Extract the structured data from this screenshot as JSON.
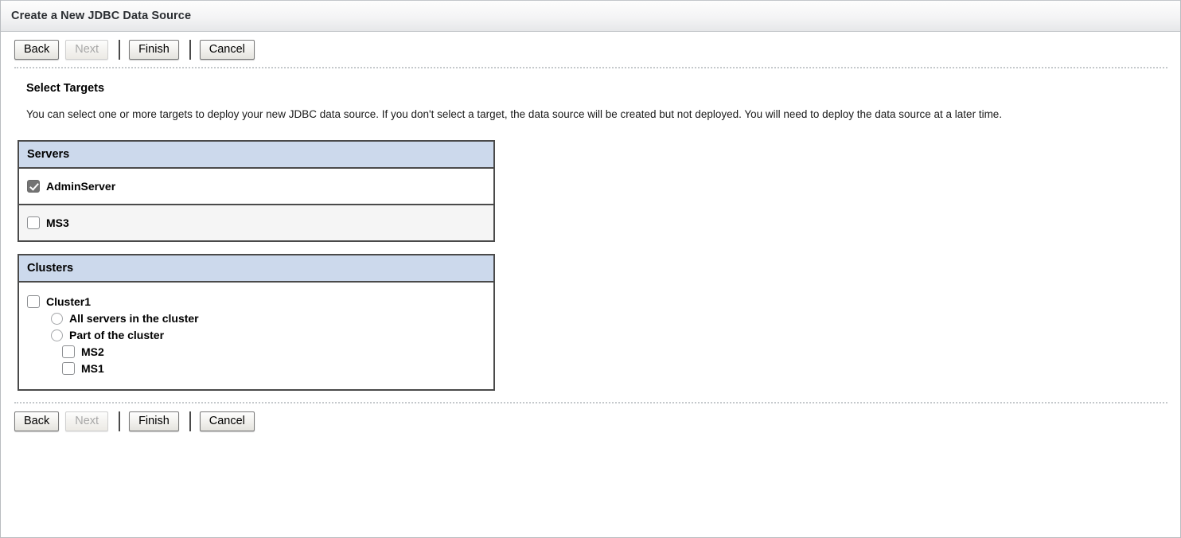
{
  "window": {
    "title": "Create a New JDBC Data Source"
  },
  "toolbar": {
    "back_label": "Back",
    "next_label": "Next",
    "finish_label": "Finish",
    "cancel_label": "Cancel"
  },
  "page": {
    "section_title": "Select Targets",
    "description": "You can select one or more targets to deploy your new JDBC data source. If you don't select a target, the data source will be created but not deployed. You will need to deploy the data source at a later time."
  },
  "servers_box": {
    "header": "Servers",
    "rows": [
      {
        "label": "AdminServer",
        "checked": true
      },
      {
        "label": "MS3",
        "checked": false
      }
    ]
  },
  "clusters_box": {
    "header": "Clusters",
    "cluster": {
      "label": "Cluster1",
      "checked": false
    },
    "options": [
      {
        "label": "All servers in the cluster",
        "selected": false
      },
      {
        "label": "Part of the cluster",
        "selected": false
      }
    ],
    "members": [
      {
        "label": "MS2",
        "checked": false
      },
      {
        "label": "MS1",
        "checked": false
      }
    ]
  },
  "colors": {
    "header_blue": "#ccd9ec",
    "box_border": "#4a4a4a",
    "alt_row": "#f5f5f5",
    "checkbox_checked": "#737373"
  }
}
